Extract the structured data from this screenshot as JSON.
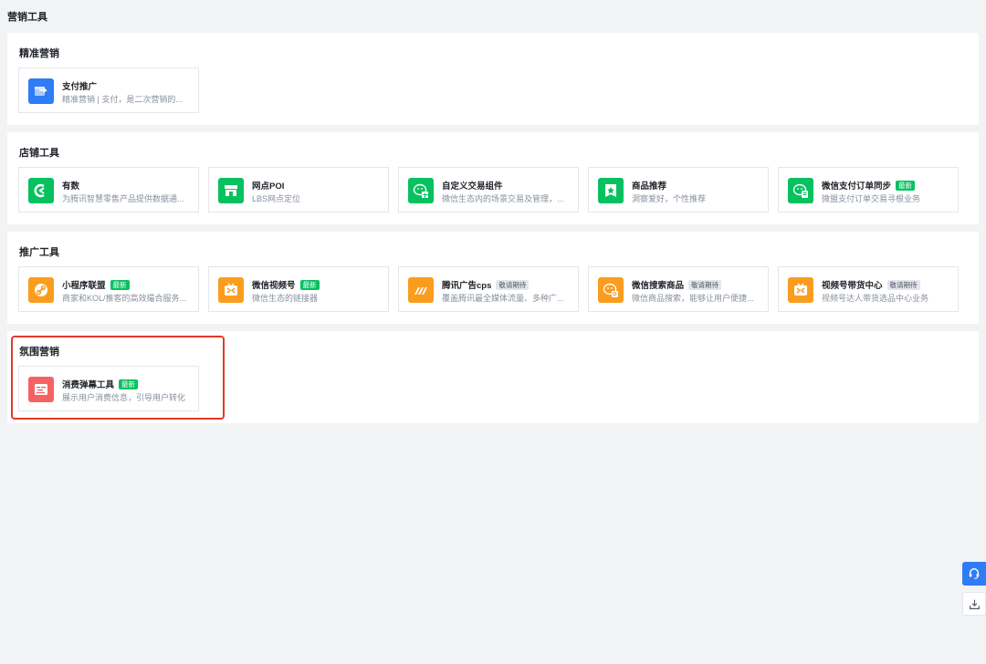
{
  "page_title": "营销工具",
  "sections": [
    {
      "title": "精准营销",
      "cards": [
        {
          "name": "支付推广",
          "desc": "精准营销 | 支付，是二次营销的...",
          "badge": ""
        }
      ]
    },
    {
      "title": "店铺工具",
      "cards": [
        {
          "name": "有数",
          "desc": "为腾讯智慧零售产品提供数据通...",
          "badge": ""
        },
        {
          "name": "网点POI",
          "desc": "LBS网点定位",
          "badge": ""
        },
        {
          "name": "自定义交易组件",
          "desc": "微信生态内的场景交易及管理，...",
          "badge": ""
        },
        {
          "name": "商品推荐",
          "desc": "洞察爱好，个性推荐",
          "badge": ""
        },
        {
          "name": "微信支付订单同步",
          "desc": "微盟支付订单交易寻根业务",
          "badge": "最新"
        }
      ]
    },
    {
      "title": "推广工具",
      "cards": [
        {
          "name": "小程序联盟",
          "desc": "商家和KOL/推客的高效撮合服务...",
          "badge": "最新"
        },
        {
          "name": "微信视频号",
          "desc": "微信生态的链接器",
          "badge": "最新"
        },
        {
          "name": "腾讯广告cps",
          "desc": "覆盖腾讯最全媒体流量、多种广...",
          "badge": "敬请期待"
        },
        {
          "name": "微信搜索商品",
          "desc": "微信商品搜索，能够让用户便捷...",
          "badge": "敬请期待"
        },
        {
          "name": "视频号带货中心",
          "desc": "视频号达人带货选品中心业务",
          "badge": "敬请期待"
        }
      ]
    },
    {
      "title": "氛围营销",
      "cards": [
        {
          "name": "消费弹幕工具",
          "desc": "展示用户消费信息，引导用户转化",
          "badge": "最新"
        }
      ]
    }
  ],
  "icons": {
    "pay-promo": "pay-promo-icon",
    "youshu": "youshu-icon",
    "poi": "store-icon",
    "trade": "wechat-grid-icon",
    "recommend": "star-bookmark-icon",
    "order-sync": "wechat-doc-icon",
    "miniapp": "link-icon",
    "channels": "tv-butterfly-icon",
    "ads": "stripes-icon",
    "search": "wechat-search-icon",
    "live": "tv-butterfly-icon",
    "danmaku": "danmaku-icon"
  },
  "colors": {
    "green": "#07c160",
    "blue": "#2f7cf6",
    "orange": "#fa9d1e",
    "red": "#f56262",
    "highlight": "#e4382c"
  }
}
